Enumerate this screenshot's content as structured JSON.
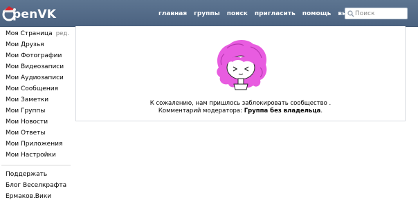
{
  "brand": {
    "name": "OpenVK",
    "text_tail": "penVK"
  },
  "header": {
    "nav": [
      {
        "label": "главная"
      },
      {
        "label": "группы"
      },
      {
        "label": "поиск"
      },
      {
        "label": "пригласить"
      },
      {
        "label": "помощь"
      },
      {
        "label": "выйти"
      }
    ],
    "search": {
      "placeholder": "Поиск",
      "icon": "search-icon"
    }
  },
  "sidebar": {
    "items": [
      {
        "label": "Моя Страница",
        "edit": "ред."
      },
      {
        "label": "Мои Друзья"
      },
      {
        "label": "Мои Фотографии"
      },
      {
        "label": "Мои Видеозаписи"
      },
      {
        "label": "Мои Аудиозаписи"
      },
      {
        "label": "Мои Сообщения"
      },
      {
        "label": "Мои Заметки"
      },
      {
        "label": "Мои Группы"
      },
      {
        "label": "Мои Новости"
      },
      {
        "label": "Мои Ответы"
      },
      {
        "label": "Мои Приложения"
      },
      {
        "label": "Мои Настройки"
      }
    ],
    "extra": [
      {
        "label": "Поддержать"
      },
      {
        "label": "Блог Веселкрафта"
      },
      {
        "label": "Ермаков.Вики"
      }
    ]
  },
  "main": {
    "message_line1": "К сожалению, нам пришлось заблокировать сообщество .",
    "comment_label": "Комментарий модератора:",
    "comment_value": "Группа без владельца",
    "comment_end": "."
  },
  "colors": {
    "header_bg": "#54708d",
    "accent": "#e85ce0",
    "hat": "#d8232a"
  }
}
